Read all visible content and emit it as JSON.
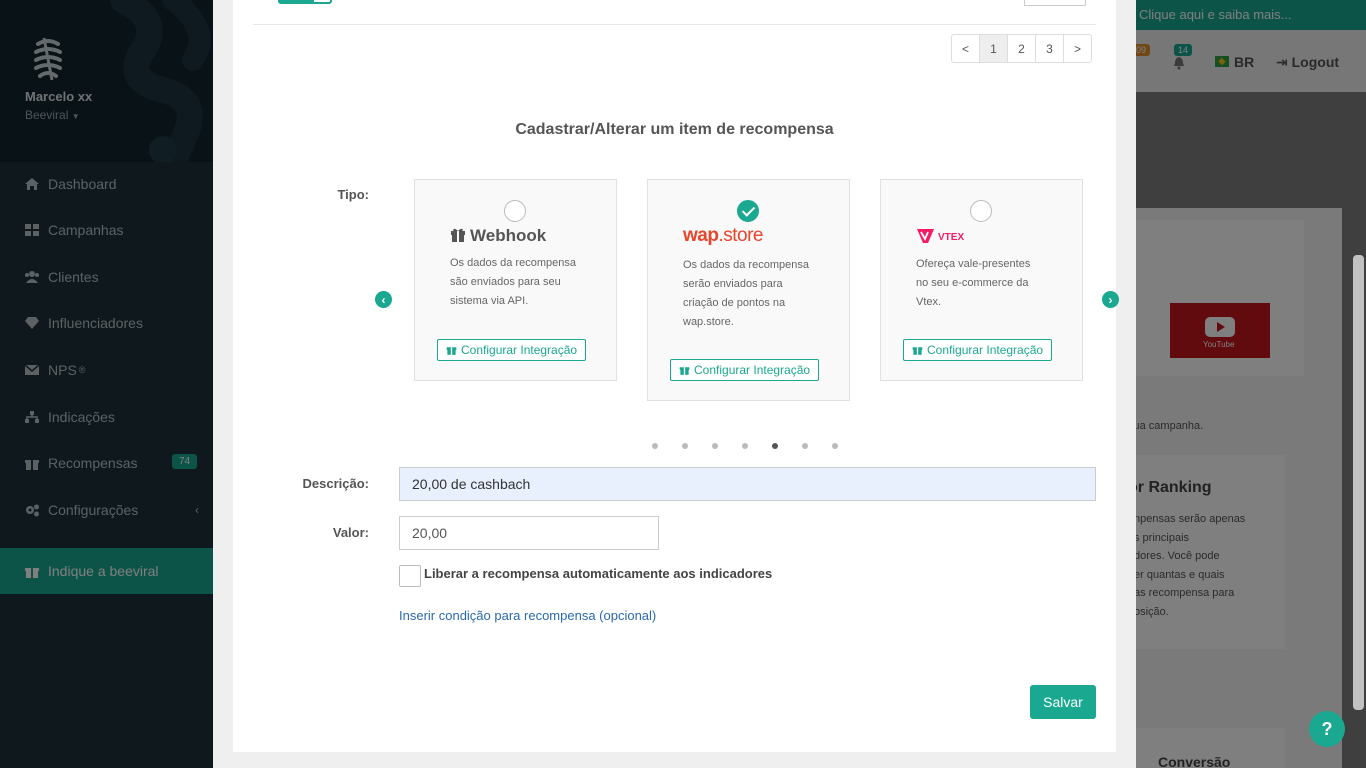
{
  "sidebar": {
    "user_name": "Marcelo xx",
    "org_name": "Beeviral",
    "items": [
      {
        "label": "Dashboard",
        "icon": "home-icon"
      },
      {
        "label": "Campanhas",
        "icon": "grid-icon"
      },
      {
        "label": "Clientes",
        "icon": "users-icon"
      },
      {
        "label": "Influenciadores",
        "icon": "diamond-icon"
      },
      {
        "label": "NPS",
        "icon": "envelope-icon",
        "superscript": "®"
      },
      {
        "label": "Indicações",
        "icon": "sitemap-icon"
      },
      {
        "label": "Recompensas",
        "icon": "gift-icon",
        "badge": "74"
      },
      {
        "label": "Configurações",
        "icon": "cogs-icon",
        "chevron": "‹"
      },
      {
        "label": "Indique a beeviral",
        "icon": "gift-icon"
      }
    ]
  },
  "topbar": {
    "promo": "Clique aqui e saiba mais...",
    "badge_a": "09",
    "badge_b": "14",
    "lang": "BR",
    "logout": "Logout"
  },
  "background": {
    "youtube_label": "YouTube",
    "hint_text": "sua campanha.",
    "ranking_title": "or Ranking",
    "ranking_lines": [
      "npensas serão apenas",
      "s principais",
      "dores. Você pode",
      "er quantas e quais",
      "as recompensa para",
      "osição."
    ],
    "conversion_label": "Conversão",
    "help": "?"
  },
  "modal": {
    "pagination": [
      "<",
      "1",
      "2",
      "3",
      ">"
    ],
    "pagination_current": "1",
    "title": "Cadastrar/Alterar um item de recompensa",
    "type_label": "Tipo:",
    "carousel_prev": "‹",
    "carousel_next": "›",
    "cards": [
      {
        "name": "Webhook",
        "desc_lines": [
          "Os dados da recompensa",
          "são enviados para seu",
          "sistema via API."
        ],
        "button": "Configurar Integração",
        "checked": false
      },
      {
        "name_a": "wap",
        "name_b": ".store",
        "desc_lines": [
          "Os dados da recompensa",
          "serão enviados para",
          "criação de pontos na",
          "wap.store."
        ],
        "button": "Configurar Integração",
        "checked": true
      },
      {
        "name": "VTEX",
        "desc_lines": [
          "Ofereça vale-presentes",
          "no seu e-commerce da",
          "Vtex."
        ],
        "button": "Configurar Integração",
        "checked": false
      }
    ],
    "dots_count": 7,
    "dots_active_index": 4,
    "description_label": "Descrição:",
    "description_value": "20,00 de cashbach",
    "value_label": "Valor:",
    "value_value": "20,00",
    "auto_release_label": "Liberar a recompensa automaticamente aos indicadores",
    "condition_link": "Inserir condição para recompensa (opcional)",
    "save_button": "Salvar"
  },
  "colors": {
    "accent": "#1aa890",
    "sidebar_bg": "#1c313b",
    "wap_brand": "#e8452c",
    "vtex_brand": "#f71963",
    "link": "#2a6ab0"
  }
}
